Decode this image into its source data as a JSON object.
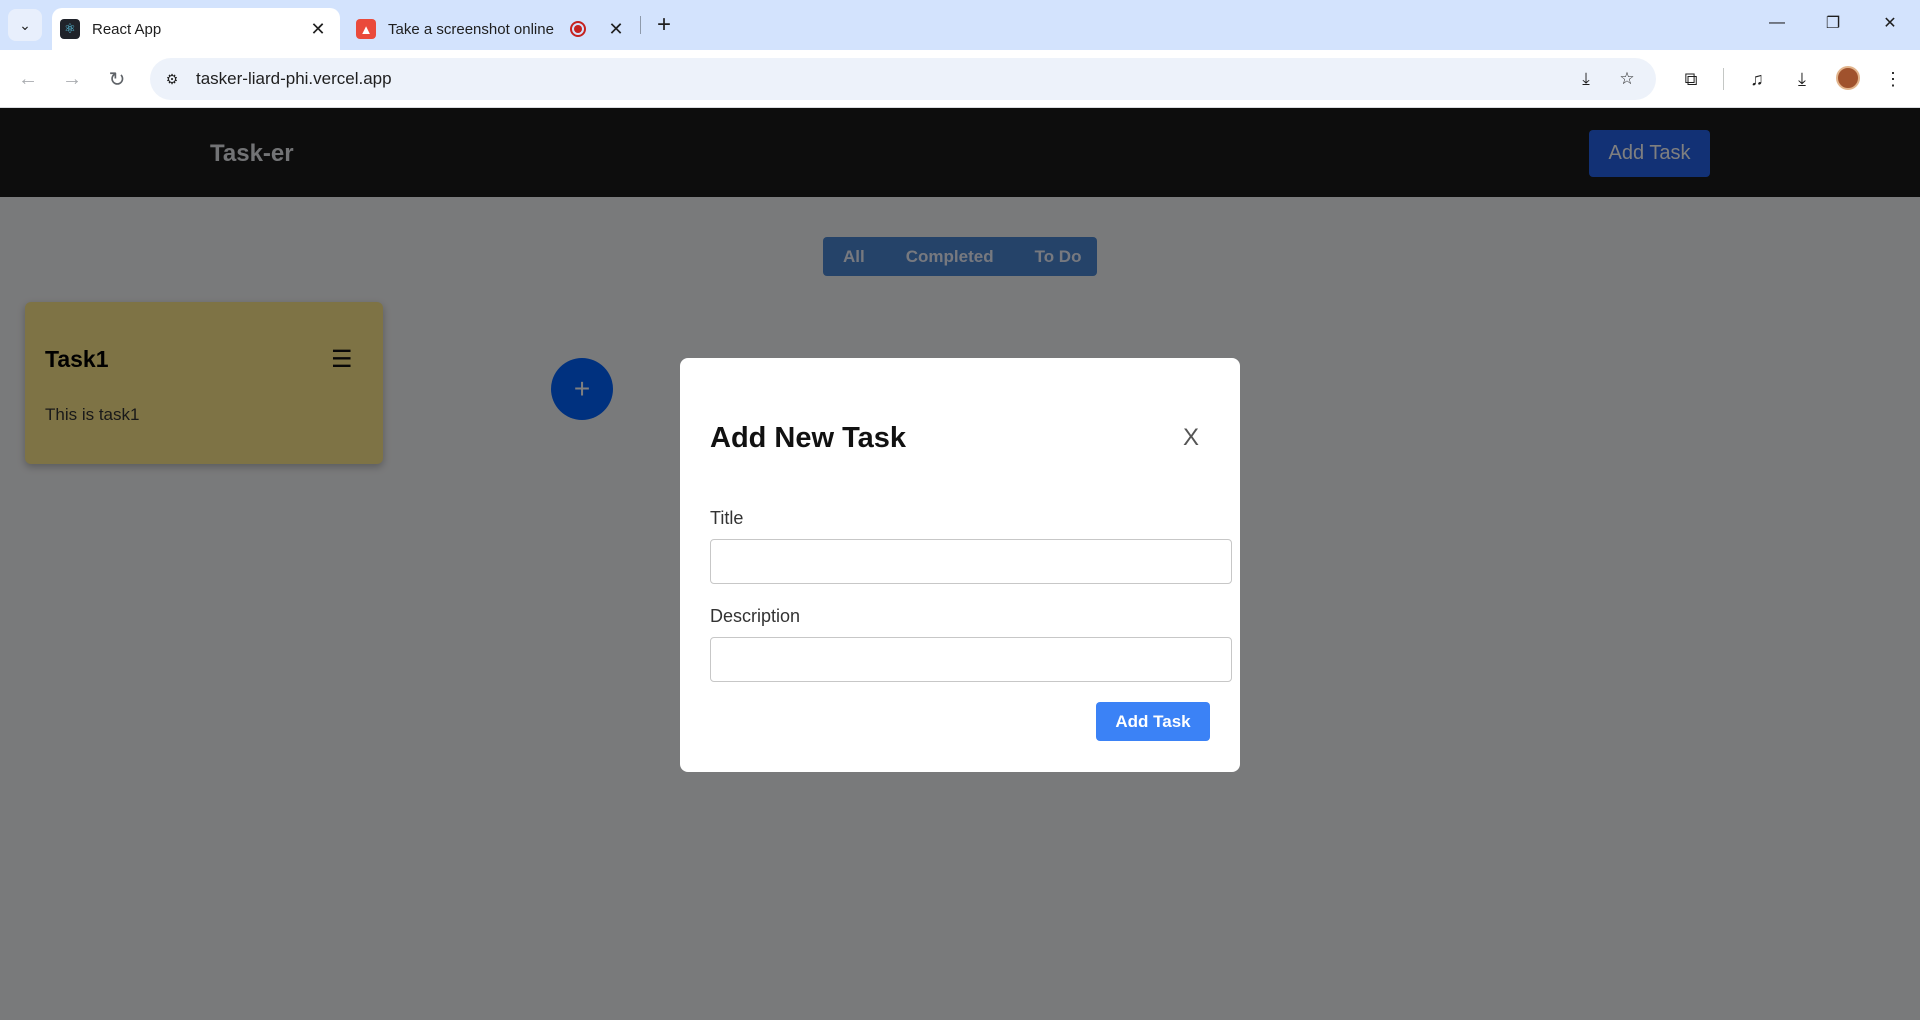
{
  "browser": {
    "tabs": [
      {
        "title": "React App",
        "favicon": "react-icon",
        "active": true
      },
      {
        "title": "Take a screenshot online",
        "favicon": "screenshot-tree-icon",
        "active": false
      }
    ],
    "url": "tasker-liard-phi.vercel.app"
  },
  "app": {
    "brand": "Task-er",
    "header_add_label": "Add Task",
    "filters": [
      "All",
      "Completed",
      "To Do"
    ],
    "tasks": [
      {
        "title": "Task1",
        "description": "This is task1",
        "color": "#fde68a"
      }
    ],
    "fab_label": "+"
  },
  "modal": {
    "title": "Add New Task",
    "close_label": "X",
    "title_label": "Title",
    "title_value": "",
    "description_label": "Description",
    "description_value": "",
    "submit_label": "Add Task"
  },
  "colors": {
    "accent": "#3b82f6",
    "header_bg": "#1a1a1a",
    "fab": "#0062ff"
  }
}
